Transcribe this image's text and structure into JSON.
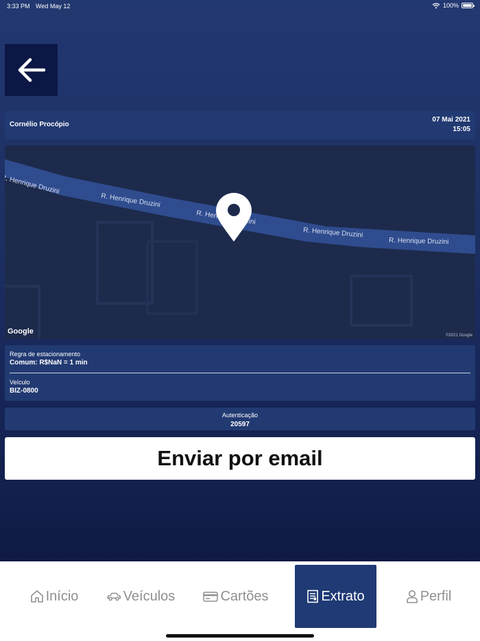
{
  "status_bar": {
    "time": "3:33 PM",
    "date": "Wed May 12",
    "battery": "100%"
  },
  "header": {
    "back_icon": "arrow-left-icon"
  },
  "parking": {
    "city": "Cornélio Procópio",
    "date": "07 Mai 2021",
    "time": "15:05"
  },
  "map": {
    "street_labels": [
      "R. Henrique Druzini",
      "R. Henrique Druzini",
      "R. Henrique Druzini",
      "R. Henrique Druzini",
      "R. Henrique Druzini"
    ],
    "logo": "Google",
    "copyright": "©2021 Google",
    "pin_icon": "map-pin-icon"
  },
  "details": {
    "rule_label": "Regra de estacionamento",
    "rule_value": "Comum: R$NaN = 1 min",
    "vehicle_label": "Veículo",
    "vehicle_value": "BIZ-0800"
  },
  "authentication": {
    "label": "Autenticação",
    "value": "20597"
  },
  "actions": {
    "send_email": "Enviar por email"
  },
  "tabs": [
    {
      "label": "Início",
      "icon": "home-icon",
      "active": false
    },
    {
      "label": "Veículos",
      "icon": "car-icon",
      "active": false
    },
    {
      "label": "Cartões",
      "icon": "credit-card-icon",
      "active": false
    },
    {
      "label": "Extrato",
      "icon": "receipt-icon",
      "active": true
    },
    {
      "label": "Perfil",
      "icon": "user-icon",
      "active": false
    }
  ],
  "colors": {
    "background": "#1c2f62",
    "card": "#223a72",
    "back_button": "#0d1746",
    "active_tab": "#1f3a74",
    "inactive_tab_text": "#8f8f8f"
  }
}
